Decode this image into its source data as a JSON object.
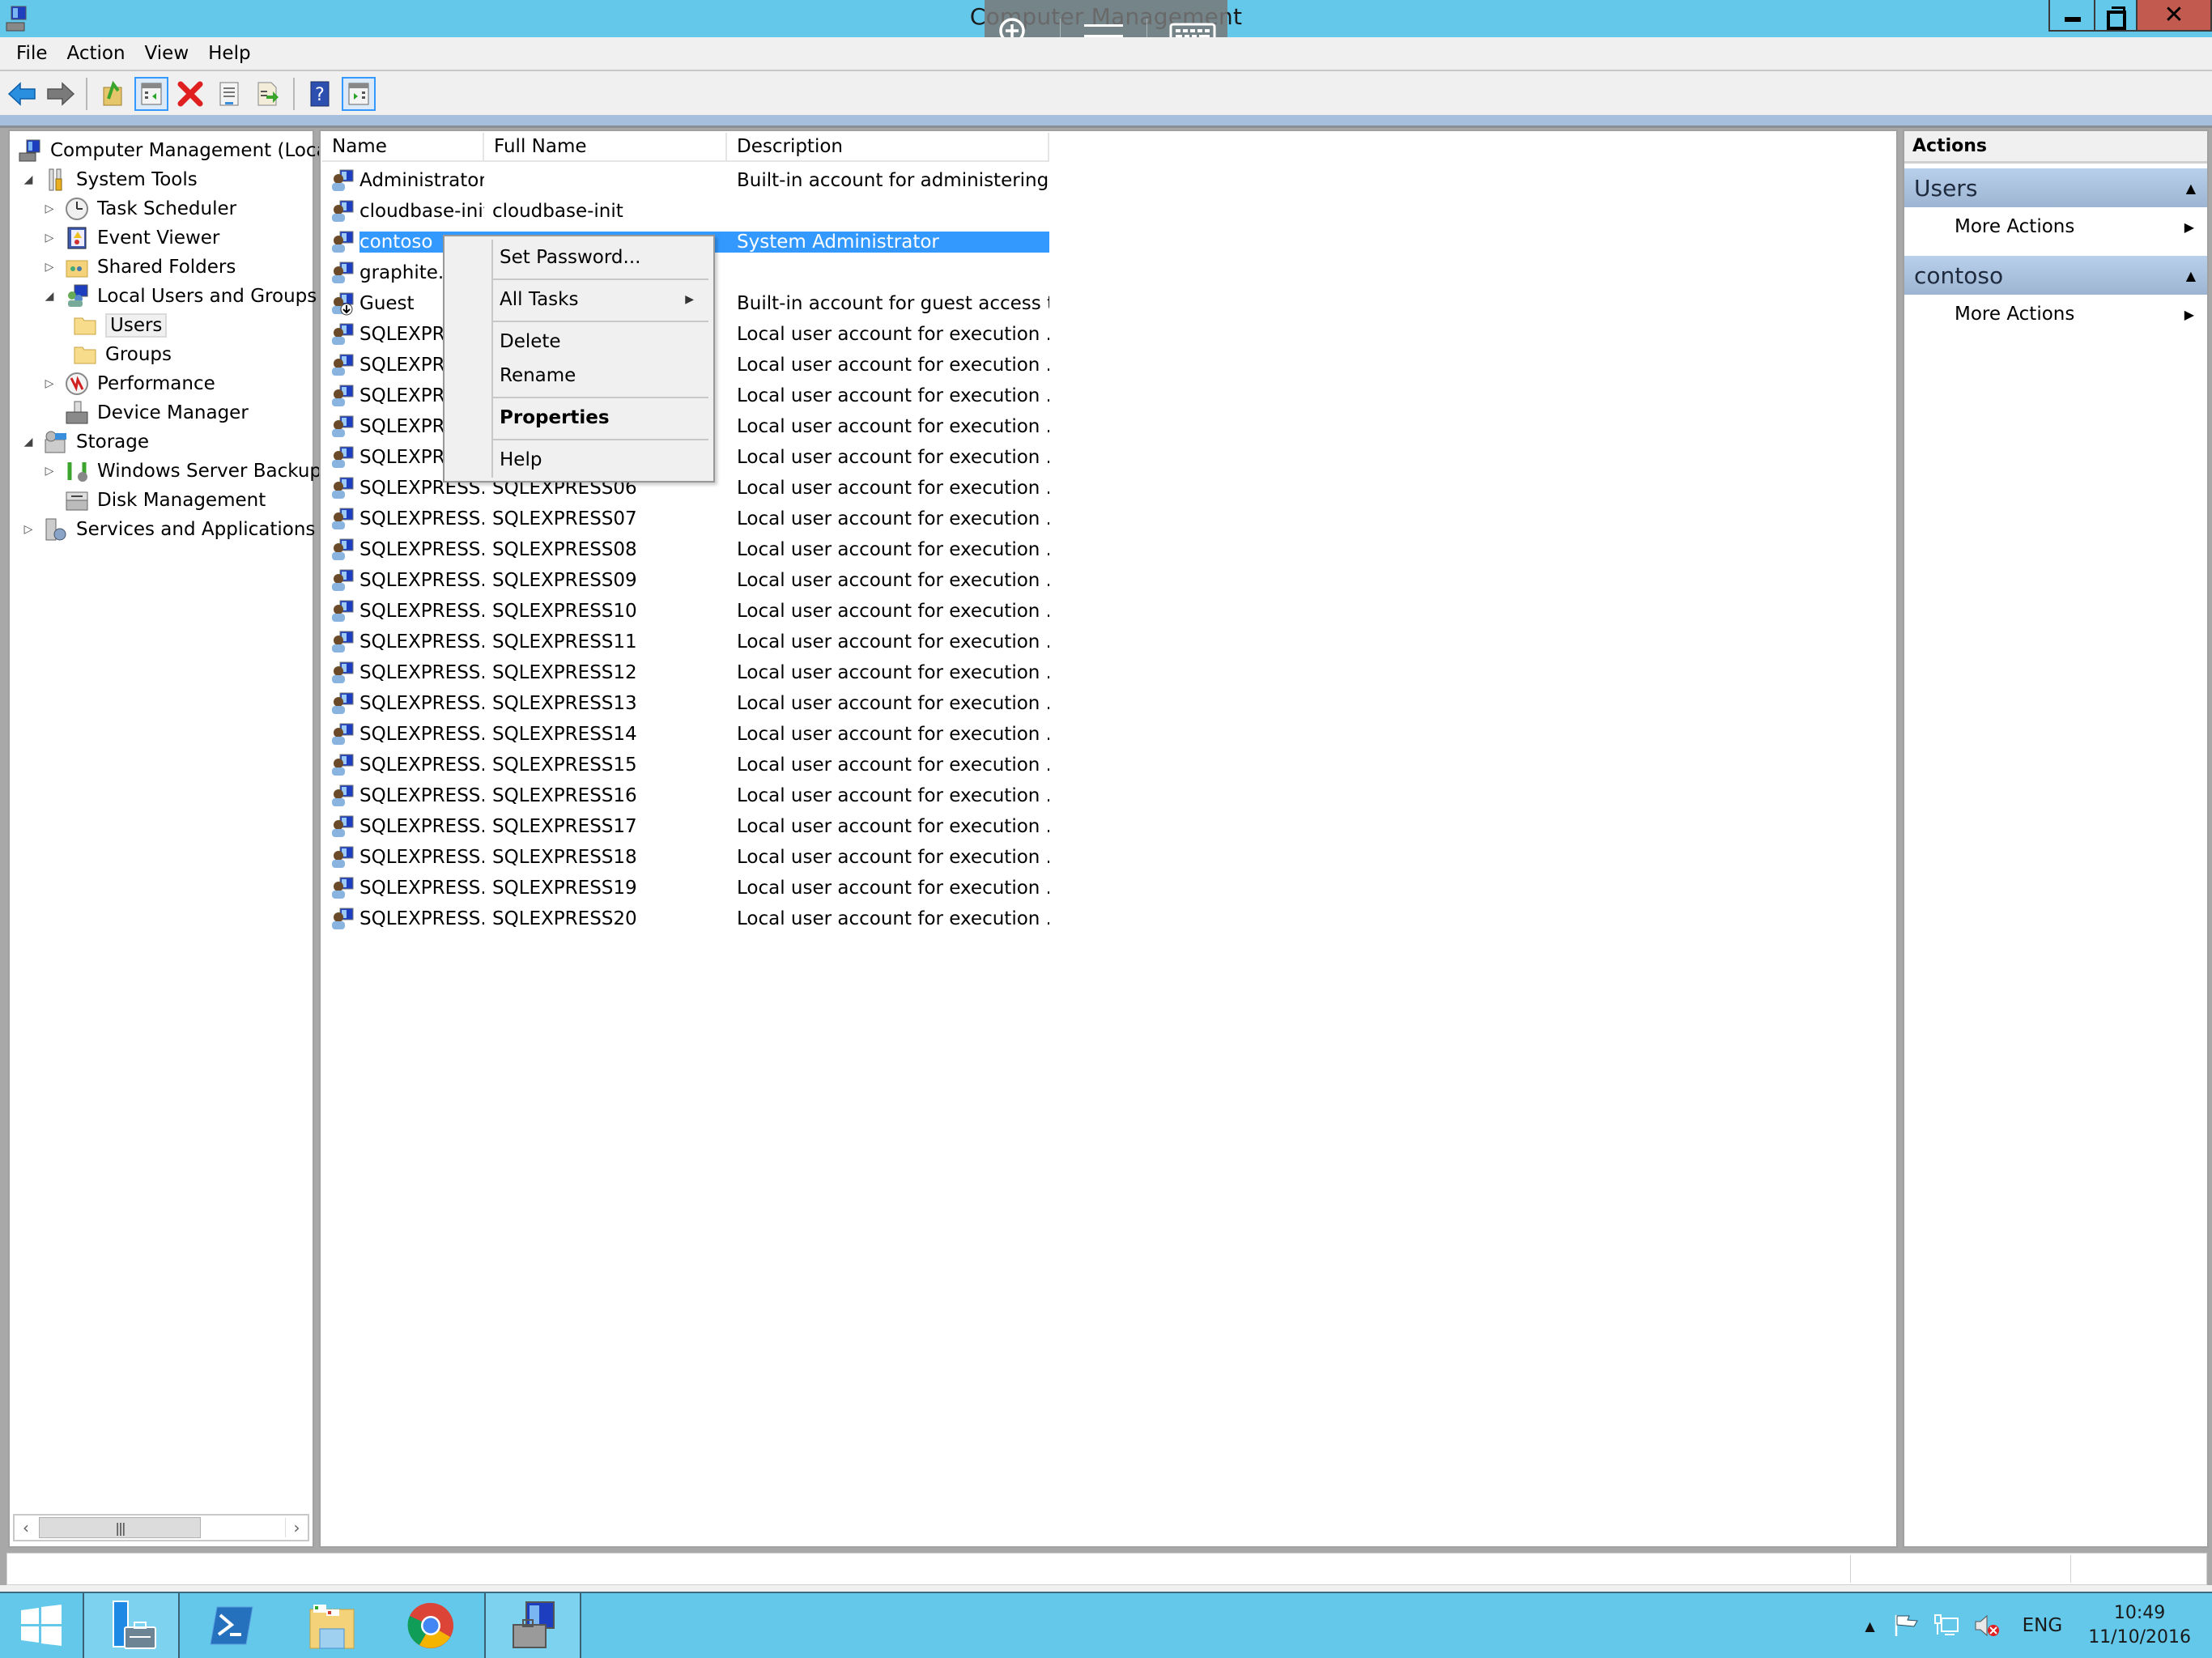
{
  "window": {
    "title": "Computer Management",
    "controls": {
      "minimize": "Minimize",
      "restore": "Restore Down",
      "close": "Close"
    }
  },
  "touch_overlay": {
    "icons": [
      "zoom-in-icon",
      "hamburger-menu-icon",
      "keyboard-icon"
    ]
  },
  "menubar": {
    "items": [
      "File",
      "Action",
      "View",
      "Help"
    ]
  },
  "toolbar": {
    "buttons": [
      "back",
      "forward",
      "up-one-level",
      "show-hide-console-tree",
      "delete",
      "properties",
      "export-list",
      "help",
      "show-hide-action-pane"
    ]
  },
  "tree": {
    "items": [
      {
        "label": "Computer Management (Local",
        "level": 0,
        "toggle": "",
        "icon": "computer-management-icon"
      },
      {
        "label": "System Tools",
        "level": 1,
        "toggle": "expanded",
        "icon": "tools-icon"
      },
      {
        "label": "Task Scheduler",
        "level": 2,
        "toggle": "collapsed",
        "icon": "clock-icon"
      },
      {
        "label": "Event Viewer",
        "level": 2,
        "toggle": "collapsed",
        "icon": "event-viewer-icon"
      },
      {
        "label": "Shared Folders",
        "level": 2,
        "toggle": "collapsed",
        "icon": "shared-folder-icon"
      },
      {
        "label": "Local Users and Groups",
        "level": 2,
        "toggle": "expanded",
        "icon": "users-groups-icon"
      },
      {
        "label": "Users",
        "level": 3,
        "toggle": "",
        "icon": "folder-icon",
        "selected": true
      },
      {
        "label": "Groups",
        "level": 3,
        "toggle": "",
        "icon": "folder-icon"
      },
      {
        "label": "Performance",
        "level": 2,
        "toggle": "collapsed",
        "icon": "performance-icon"
      },
      {
        "label": "Device Manager",
        "level": 2,
        "toggle": "",
        "icon": "device-manager-icon"
      },
      {
        "label": "Storage",
        "level": 1,
        "toggle": "expanded",
        "icon": "storage-icon"
      },
      {
        "label": "Windows Server Backup",
        "level": 2,
        "toggle": "collapsed",
        "icon": "backup-icon"
      },
      {
        "label": "Disk Management",
        "level": 2,
        "toggle": "",
        "icon": "disk-icon"
      },
      {
        "label": "Services and Applications",
        "level": 1,
        "toggle": "collapsed",
        "icon": "services-icon"
      }
    ]
  },
  "list": {
    "columns": [
      "Name",
      "Full Name",
      "Description"
    ],
    "rows": [
      {
        "name": "Administrator",
        "full_name": "",
        "description": "Built-in account for administering..."
      },
      {
        "name": "cloudbase-init",
        "full_name": "cloudbase-init",
        "description": ""
      },
      {
        "name": "contoso",
        "full_name": "",
        "description": "System Administrator",
        "selected": true
      },
      {
        "name": "graphite.r",
        "full_name": "",
        "description": ""
      },
      {
        "name": "Guest",
        "full_name": "",
        "description": "Built-in account for guest access t...",
        "disabled": true
      },
      {
        "name": "SQLEXPRE",
        "full_name": "",
        "description": "Local user account for execution ..."
      },
      {
        "name": "SQLEXPRE",
        "full_name": "",
        "description": "Local user account for execution ..."
      },
      {
        "name": "SQLEXPRE",
        "full_name": "",
        "description": "Local user account for execution ..."
      },
      {
        "name": "SQLEXPRE",
        "full_name": "",
        "description": "Local user account for execution ..."
      },
      {
        "name": "SQLEXPRE",
        "full_name": "",
        "description": "Local user account for execution ..."
      },
      {
        "name": "SQLEXPRESS...",
        "full_name": "SQLEXPRESS06",
        "description": "Local user account for execution ..."
      },
      {
        "name": "SQLEXPRESS...",
        "full_name": "SQLEXPRESS07",
        "description": "Local user account for execution ..."
      },
      {
        "name": "SQLEXPRESS...",
        "full_name": "SQLEXPRESS08",
        "description": "Local user account for execution ..."
      },
      {
        "name": "SQLEXPRESS...",
        "full_name": "SQLEXPRESS09",
        "description": "Local user account for execution ..."
      },
      {
        "name": "SQLEXPRESS...",
        "full_name": "SQLEXPRESS10",
        "description": "Local user account for execution ..."
      },
      {
        "name": "SQLEXPRESS...",
        "full_name": "SQLEXPRESS11",
        "description": "Local user account for execution ..."
      },
      {
        "name": "SQLEXPRESS...",
        "full_name": "SQLEXPRESS12",
        "description": "Local user account for execution ..."
      },
      {
        "name": "SQLEXPRESS...",
        "full_name": "SQLEXPRESS13",
        "description": "Local user account for execution ..."
      },
      {
        "name": "SQLEXPRESS...",
        "full_name": "SQLEXPRESS14",
        "description": "Local user account for execution ..."
      },
      {
        "name": "SQLEXPRESS...",
        "full_name": "SQLEXPRESS15",
        "description": "Local user account for execution ..."
      },
      {
        "name": "SQLEXPRESS...",
        "full_name": "SQLEXPRESS16",
        "description": "Local user account for execution ..."
      },
      {
        "name": "SQLEXPRESS...",
        "full_name": "SQLEXPRESS17",
        "description": "Local user account for execution ..."
      },
      {
        "name": "SQLEXPRESS...",
        "full_name": "SQLEXPRESS18",
        "description": "Local user account for execution ..."
      },
      {
        "name": "SQLEXPRESS...",
        "full_name": "SQLEXPRESS19",
        "description": "Local user account for execution ..."
      },
      {
        "name": "SQLEXPRESS...",
        "full_name": "SQLEXPRESS20",
        "description": "Local user account for execution ..."
      }
    ]
  },
  "context_menu": {
    "items": [
      {
        "label": "Set Password...",
        "bold": false,
        "submenu": false
      },
      {
        "separator": true
      },
      {
        "label": "All Tasks",
        "bold": false,
        "submenu": true
      },
      {
        "separator": true
      },
      {
        "label": "Delete",
        "bold": false,
        "submenu": false
      },
      {
        "label": "Rename",
        "bold": false,
        "submenu": false
      },
      {
        "separator": true
      },
      {
        "label": "Properties",
        "bold": true,
        "submenu": false
      },
      {
        "separator": true
      },
      {
        "label": "Help",
        "bold": false,
        "submenu": false
      }
    ]
  },
  "actions": {
    "title": "Actions",
    "sections": [
      {
        "title": "Users",
        "items": [
          "More Actions"
        ]
      },
      {
        "title": "contoso",
        "items": [
          "More Actions"
        ]
      }
    ]
  },
  "taskbar": {
    "apps": [
      "start",
      "server-manager",
      "powershell",
      "file-explorer",
      "chrome",
      "computer-management"
    ],
    "tray": {
      "language": "ENG",
      "time": "10:49",
      "date": "11/10/2016"
    }
  },
  "colors": {
    "titlebar": "#63c8ea",
    "selection": "#3399ff",
    "close": "#c35a50",
    "action_header": "#b8d0ea"
  }
}
